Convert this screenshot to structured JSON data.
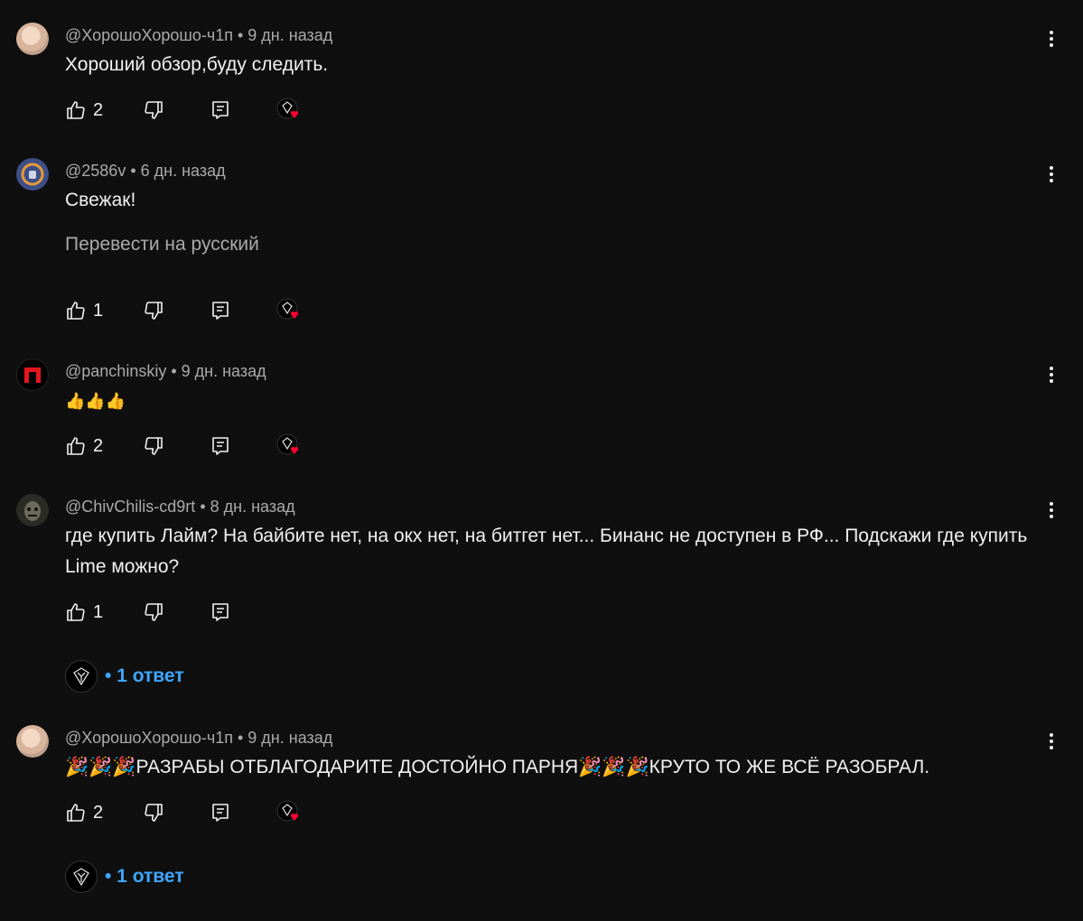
{
  "comments": [
    {
      "author": "@ХорошоХорошо-ч1п",
      "time": "9 дн. назад",
      "text": "Хороший обзор,буду следить.",
      "likes": "2",
      "avatar_icon": "doll-avatar-icon",
      "creator_heart": true
    },
    {
      "author": "@2586v",
      "time": "6 дн. назад",
      "text": "Свежак!",
      "translate": "Перевести на русский",
      "likes": "1",
      "avatar_icon": "headphones-avatar-icon",
      "creator_heart": true
    },
    {
      "author": "@panchinskiy",
      "time": "9 дн. назад",
      "text": "👍👍👍",
      "likes": "2",
      "avatar_icon": "red-p-logo-avatar-icon",
      "creator_heart": true
    },
    {
      "author": "@ChivChilis-cd9rt",
      "time": "8 дн. назад",
      "text": "где купить Лайм? На байбите нет, на окх нет, на битгет нет... Бинанс не доступен в РФ... Подскажи где купить Lime можно?",
      "likes": "1",
      "avatar_icon": "mask-avatar-icon",
      "creator_heart": false,
      "replies": "• 1 ответ"
    },
    {
      "author": "@ХорошоХорошо-ч1п",
      "time": "9 дн. назад",
      "text": "🎉🎉🎉РАЗРАБЫ ОТБЛАГОДАРИТЕ ДОСТОЙНО ПАРНЯ🎉🎉🎉КРУТО ТО ЖЕ ВСЁ РАЗОБРАЛ.",
      "likes": "2",
      "avatar_icon": "doll-avatar-icon",
      "creator_heart": true,
      "replies": "• 1 ответ"
    }
  ],
  "separator": "•",
  "colors": {
    "background": "#0f0f0f",
    "text": "#f1f1f1",
    "meta": "#aaaaaa",
    "link": "#3ea6ff",
    "heart": "#ff0033"
  }
}
